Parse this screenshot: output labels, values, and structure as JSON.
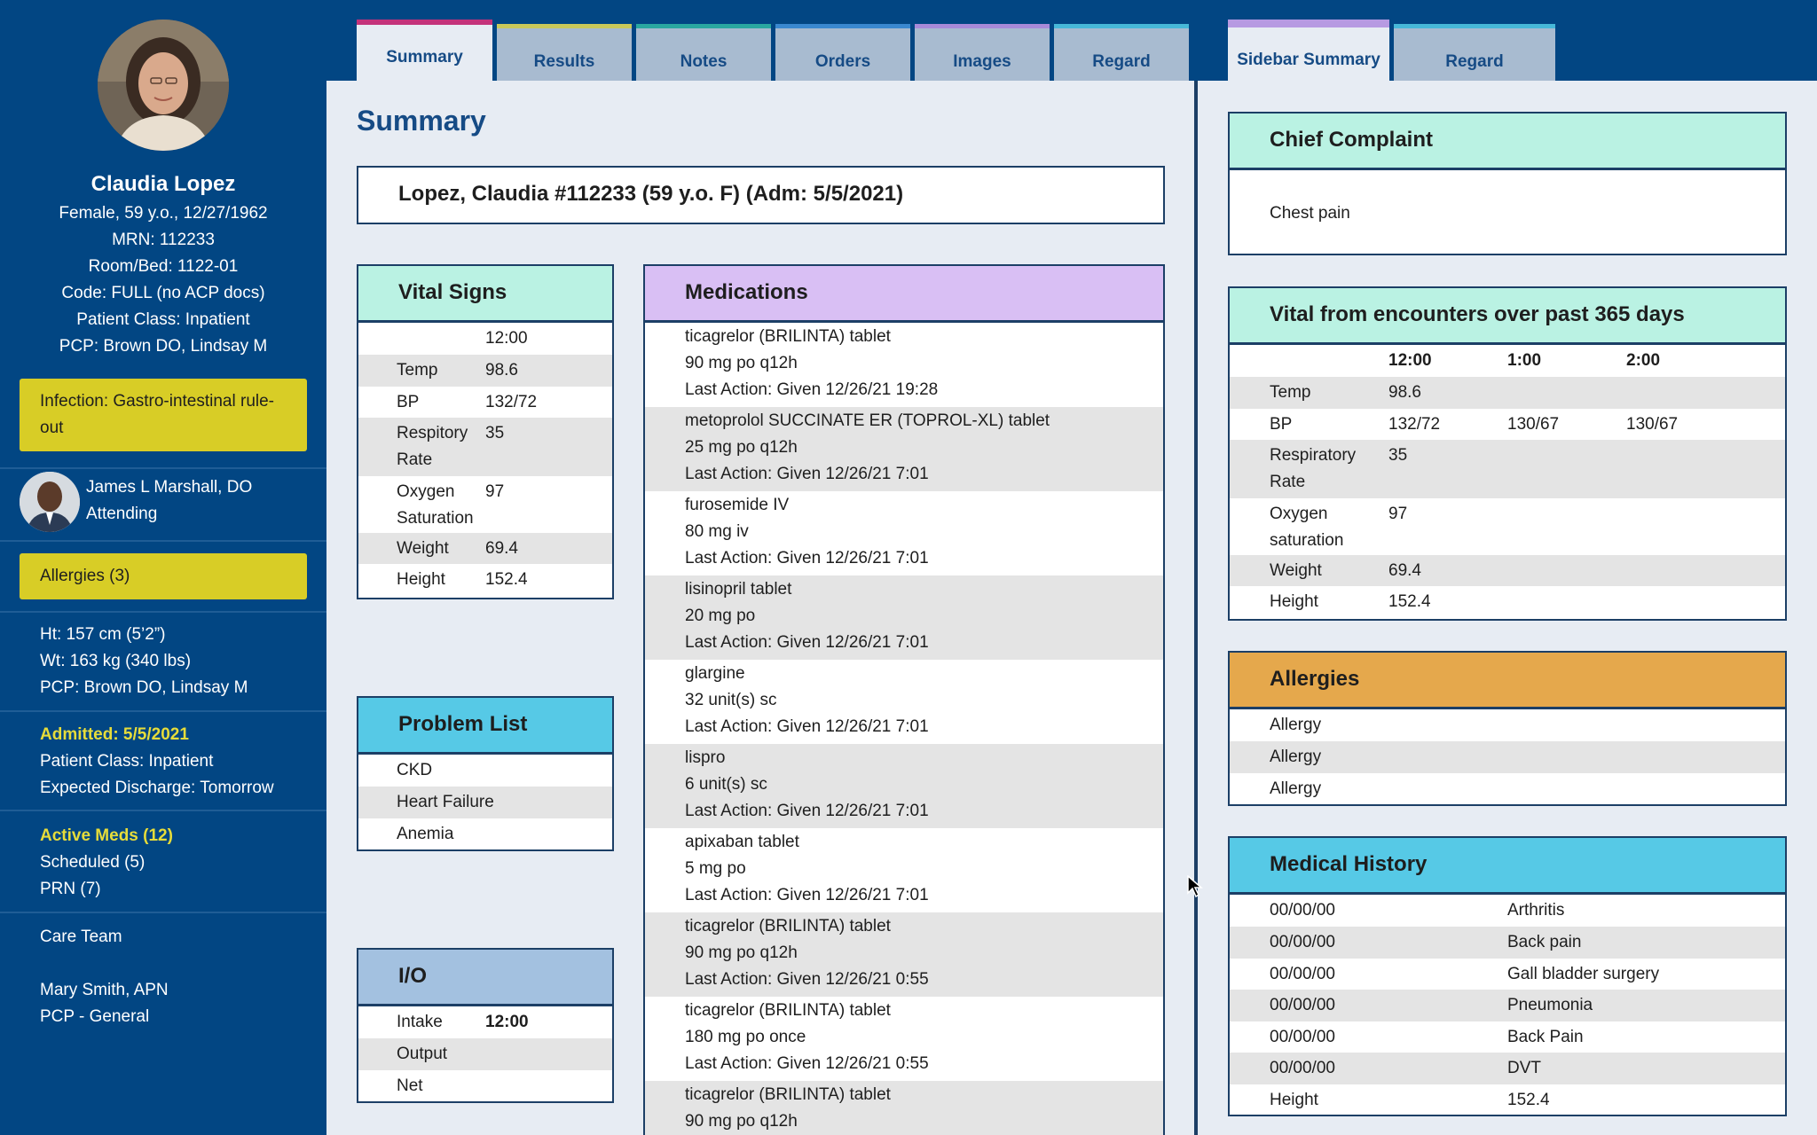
{
  "patient": {
    "name": "Claudia Lopez",
    "lines": [
      "Female, 59 y.o., 12/27/1962",
      "MRN: 112233",
      "Room/Bed: 1122-01",
      "Code: FULL (no ACP docs)",
      "Patient Class: Inpatient",
      "PCP: Brown DO, Lindsay M"
    ]
  },
  "sidebar": {
    "infection": "Infection: Gastro-intestinal rule-out",
    "attending_name": "James L Marshall, DO",
    "attending_role": "Attending",
    "allergies_label": "Allergies (3)",
    "body": [
      "Ht: 157 cm (5’2”)",
      "Wt: 163 kg (340 lbs)",
      "PCP: Brown DO, Lindsay M"
    ],
    "admitted": "Admitted: 5/5/2021",
    "admit_lines": [
      "Patient Class: Inpatient",
      "Expected Discharge: Tomorrow"
    ],
    "active_meds": "Active Meds (12)",
    "meds_lines": [
      "Scheduled (5)",
      "PRN (7)"
    ],
    "care_team": "Care Team",
    "care_lines": [
      "Mary Smith, APN",
      "PCP - General"
    ]
  },
  "tabs": [
    {
      "label": "Summary",
      "color": "#c4327a",
      "active": true
    },
    {
      "label": "Results",
      "color": "#c9c85a"
    },
    {
      "label": "Notes",
      "color": "#2aa7a0"
    },
    {
      "label": "Orders",
      "color": "#3a88d0"
    },
    {
      "label": "Images",
      "color": "#a78ad8"
    },
    {
      "label": "Regard",
      "color": "#47b8d8"
    }
  ],
  "side_tabs": [
    {
      "label": "Sidebar Summary",
      "color": "#b79ae2",
      "active": true
    },
    {
      "label": "Regard",
      "color": "#47b8d8"
    }
  ],
  "main": {
    "title": "Summary",
    "header": "Lopez, Claudia #112233 (59 y.o. F) (Adm: 5/5/2021)"
  },
  "vitals": {
    "title": "Vital Signs",
    "time": "12:00",
    "rows": [
      {
        "label": "Temp",
        "value": "98.6"
      },
      {
        "label": "BP",
        "value": "132/72"
      },
      {
        "label": "Respitory Rate",
        "value": "35"
      },
      {
        "label": "Oxygen Saturation",
        "value": "97"
      },
      {
        "label": "Weight",
        "value": "69.4"
      },
      {
        "label": "Height",
        "value": "152.4"
      }
    ]
  },
  "problems": {
    "title": "Problem List",
    "items": [
      "CKD",
      "Heart Failure",
      "Anemia"
    ]
  },
  "io": {
    "title": "I/O",
    "rows": [
      {
        "label": "Intake",
        "value": "12:00"
      },
      {
        "label": "Output",
        "value": ""
      },
      {
        "label": "Net",
        "value": ""
      }
    ]
  },
  "meds": {
    "title": "Medications",
    "items": [
      {
        "name": "ticagrelor (BRILINTA) tablet",
        "dose": "90 mg po q12h",
        "last": "Last Action: Given 12/26/21 19:28"
      },
      {
        "name": "metoprolol SUCCINATE ER (TOPROL-XL) tablet",
        "dose": "25 mg po q12h",
        "last": "Last Action: Given 12/26/21 7:01"
      },
      {
        "name": "furosemide IV",
        "dose": "80 mg iv",
        "last": "Last Action: Given 12/26/21 7:01"
      },
      {
        "name": "lisinopril tablet",
        "dose": "20 mg po",
        "last": "Last Action: Given 12/26/21 7:01"
      },
      {
        "name": "glargine",
        "dose": "32 unit(s) sc",
        "last": "Last Action: Given 12/26/21 7:01"
      },
      {
        "name": "lispro",
        "dose": "6 unit(s) sc",
        "last": "Last Action: Given 12/26/21 7:01"
      },
      {
        "name": "apixaban tablet",
        "dose": "5 mg po",
        "last": "Last Action: Given 12/26/21 7:01"
      },
      {
        "name": "ticagrelor (BRILINTA) tablet",
        "dose": "90 mg po q12h",
        "last": "Last Action: Given 12/26/21 0:55"
      },
      {
        "name": "ticagrelor (BRILINTA) tablet",
        "dose": "180 mg po once",
        "last": "Last Action: Given 12/26/21 0:55"
      },
      {
        "name": "ticagrelor (BRILINTA) tablet",
        "dose": "90 mg po q12h",
        "last": ""
      }
    ]
  },
  "chief": {
    "title": "Chief Complaint",
    "text": "Chest pain"
  },
  "enc": {
    "title": "Vital from encounters over past 365 days",
    "times": [
      "12:00",
      "1:00",
      "2:00"
    ],
    "rows": [
      {
        "label": "Temp",
        "v": [
          "98.6",
          "",
          ""
        ]
      },
      {
        "label": "BP",
        "v": [
          "132/72",
          "130/67",
          "130/67"
        ]
      },
      {
        "label": "Respiratory Rate",
        "v": [
          "35",
          "",
          ""
        ]
      },
      {
        "label": "Oxygen saturation",
        "v": [
          "97",
          "",
          ""
        ]
      },
      {
        "label": "Weight",
        "v": [
          "69.4",
          "",
          ""
        ]
      },
      {
        "label": "Height",
        "v": [
          "152.4",
          "",
          ""
        ]
      }
    ]
  },
  "allergies": {
    "title": "Allergies",
    "items": [
      "Allergy",
      "Allergy",
      "Allergy"
    ]
  },
  "history": {
    "title": "Medical History",
    "rows": [
      {
        "date": "00/00/00",
        "item": "Arthritis"
      },
      {
        "date": "00/00/00",
        "item": "Back pain"
      },
      {
        "date": "00/00/00",
        "item": "Gall bladder surgery"
      },
      {
        "date": "00/00/00",
        "item": "Pneumonia"
      },
      {
        "date": "00/00/00",
        "item": "Back Pain"
      },
      {
        "date": "00/00/00",
        "item": "DVT"
      },
      {
        "date": "Height",
        "item": "152.4"
      }
    ]
  },
  "colors": {
    "teal_head": "#baf2e3",
    "purple_head": "#d9bff4",
    "cyan_head": "#56c9e6",
    "blue_head": "#a3c1e0",
    "orange_head": "#e5a84c",
    "highlight": "#d8cd26"
  }
}
